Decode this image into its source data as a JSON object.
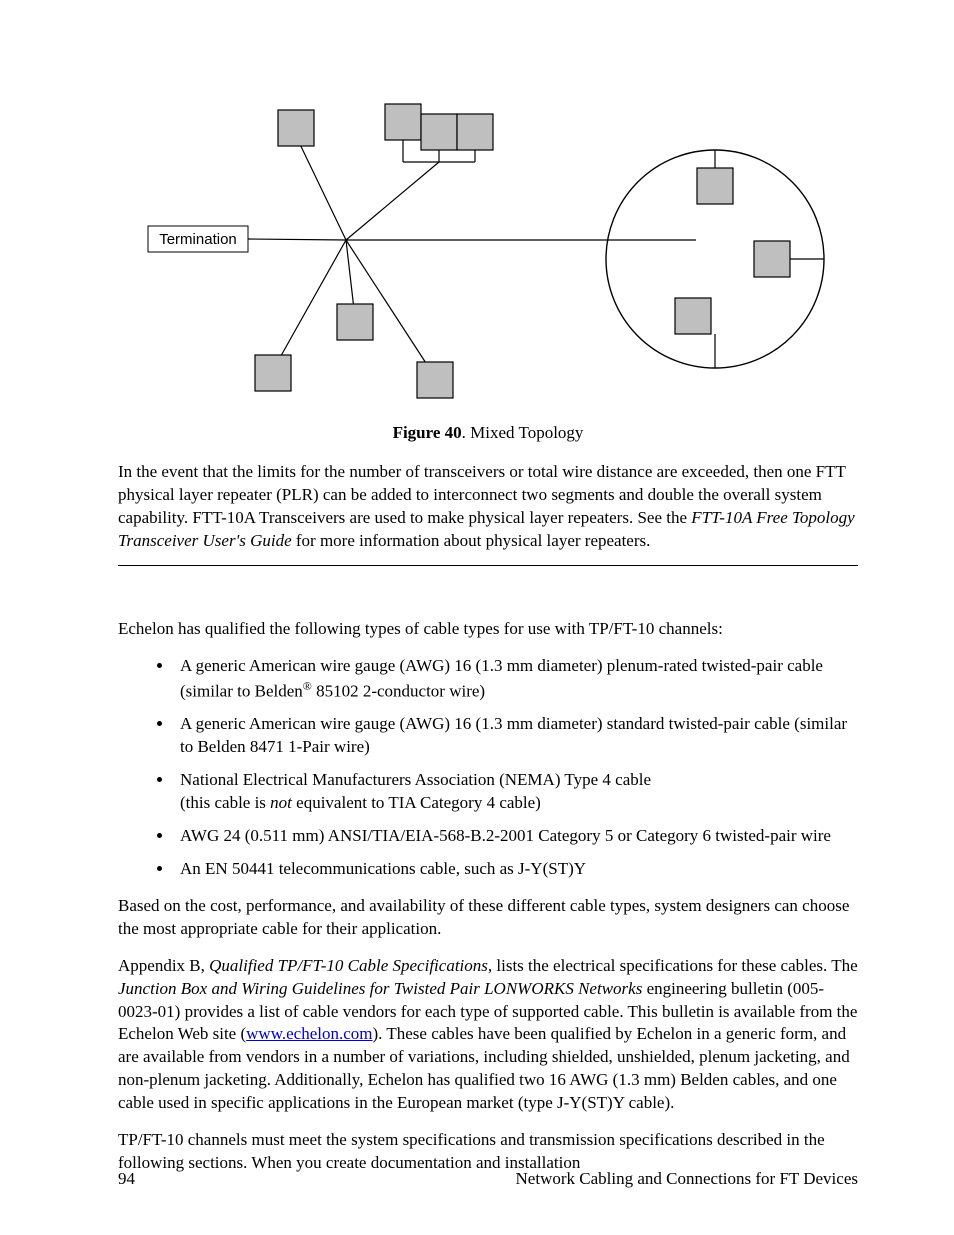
{
  "diagram": {
    "termination_label": "Termination"
  },
  "figure": {
    "label": "Figure 40",
    "caption": ". Mixed Topology"
  },
  "para_after_figure": {
    "pre": "In the event that the limits for the number of transceivers or total wire distance are exceeded, then one FTT physical layer repeater (PLR) can be added to interconnect two segments and double the overall system capability.  FTT-10A Transceivers are used to make physical layer repeaters.  See the ",
    "italic": "FTT-10A Free Topology Transceiver User's Guide",
    "post": " for more information about physical layer repeaters."
  },
  "intro_sentence": "Echelon has qualified the following types of cable types for use with TP/FT-10 channels:",
  "bullets": {
    "b1_pre": "A generic American wire gauge (AWG) 16 (1.3 mm diameter) plenum-rated twisted-pair cable (similar to Belden",
    "b1_sup": "®",
    "b1_post": " 85102 2-conductor wire)",
    "b2": "A generic American wire gauge (AWG) 16 (1.3 mm diameter) standard twisted-pair cable (similar to Belden 8471 1-Pair wire)",
    "b3_line1": "National Electrical Manufacturers Association (NEMA) Type 4 cable",
    "b3_line2_pre": "(this cable is ",
    "b3_line2_italic": "not",
    "b3_line2_post": " equivalent to TIA Category 4 cable)",
    "b4": "AWG 24 (0.511 mm) ANSI/TIA/EIA-568-B.2-2001 Category 5 or Category 6 twisted-pair wire",
    "b5": "An EN 50441 telecommunications cable, such as J-Y(ST)Y"
  },
  "para_based_on": "Based on the cost, performance, and availability of these different cable types, system designers can choose the most appropriate cable for their application.",
  "para_appendix": {
    "pre": "Appendix B, ",
    "italic1": "Qualified TP/FT-10 Cable Specifications",
    "mid1": ", lists the electrical specifications for these cables.  The ",
    "italic2": "Junction Box and Wiring Guidelines for Twisted Pair LONWORKS Networks",
    "mid2": " engineering bulletin (005-0023-01) provides a list of cable vendors for each type of supported cable.  This bulletin is available from the Echelon Web site (",
    "link_text": "www.echelon.com",
    "post": ").  These cables have been qualified by Echelon in a generic form, and are available from vendors in a number of variations, including shielded, unshielded, plenum jacketing, and non-plenum jacketing.  Additionally, Echelon has qualified two 16 AWG (1.3 mm) Belden cables, and one cable used in specific applications in the European market (type J-Y(ST)Y cable)."
  },
  "para_final": "TP/FT-10 channels must meet the system specifications and transmission specifications described in the following sections.  When you create documentation and installation",
  "footer": {
    "page": "94",
    "title": "Network Cabling and Connections for FT Devices"
  }
}
